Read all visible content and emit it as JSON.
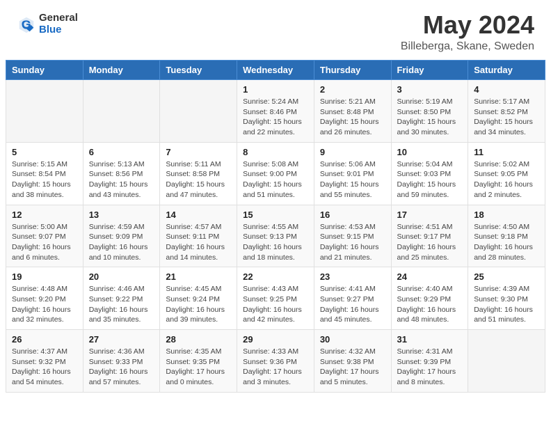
{
  "header": {
    "logo_general": "General",
    "logo_blue": "Blue",
    "month_year": "May 2024",
    "location": "Billeberga, Skane, Sweden"
  },
  "days_of_week": [
    "Sunday",
    "Monday",
    "Tuesday",
    "Wednesday",
    "Thursday",
    "Friday",
    "Saturday"
  ],
  "weeks": [
    [
      {
        "day": "",
        "content": ""
      },
      {
        "day": "",
        "content": ""
      },
      {
        "day": "",
        "content": ""
      },
      {
        "day": "1",
        "content": "Sunrise: 5:24 AM\nSunset: 8:46 PM\nDaylight: 15 hours\nand 22 minutes."
      },
      {
        "day": "2",
        "content": "Sunrise: 5:21 AM\nSunset: 8:48 PM\nDaylight: 15 hours\nand 26 minutes."
      },
      {
        "day": "3",
        "content": "Sunrise: 5:19 AM\nSunset: 8:50 PM\nDaylight: 15 hours\nand 30 minutes."
      },
      {
        "day": "4",
        "content": "Sunrise: 5:17 AM\nSunset: 8:52 PM\nDaylight: 15 hours\nand 34 minutes."
      }
    ],
    [
      {
        "day": "5",
        "content": "Sunrise: 5:15 AM\nSunset: 8:54 PM\nDaylight: 15 hours\nand 38 minutes."
      },
      {
        "day": "6",
        "content": "Sunrise: 5:13 AM\nSunset: 8:56 PM\nDaylight: 15 hours\nand 43 minutes."
      },
      {
        "day": "7",
        "content": "Sunrise: 5:11 AM\nSunset: 8:58 PM\nDaylight: 15 hours\nand 47 minutes."
      },
      {
        "day": "8",
        "content": "Sunrise: 5:08 AM\nSunset: 9:00 PM\nDaylight: 15 hours\nand 51 minutes."
      },
      {
        "day": "9",
        "content": "Sunrise: 5:06 AM\nSunset: 9:01 PM\nDaylight: 15 hours\nand 55 minutes."
      },
      {
        "day": "10",
        "content": "Sunrise: 5:04 AM\nSunset: 9:03 PM\nDaylight: 15 hours\nand 59 minutes."
      },
      {
        "day": "11",
        "content": "Sunrise: 5:02 AM\nSunset: 9:05 PM\nDaylight: 16 hours\nand 2 minutes."
      }
    ],
    [
      {
        "day": "12",
        "content": "Sunrise: 5:00 AM\nSunset: 9:07 PM\nDaylight: 16 hours\nand 6 minutes."
      },
      {
        "day": "13",
        "content": "Sunrise: 4:59 AM\nSunset: 9:09 PM\nDaylight: 16 hours\nand 10 minutes."
      },
      {
        "day": "14",
        "content": "Sunrise: 4:57 AM\nSunset: 9:11 PM\nDaylight: 16 hours\nand 14 minutes."
      },
      {
        "day": "15",
        "content": "Sunrise: 4:55 AM\nSunset: 9:13 PM\nDaylight: 16 hours\nand 18 minutes."
      },
      {
        "day": "16",
        "content": "Sunrise: 4:53 AM\nSunset: 9:15 PM\nDaylight: 16 hours\nand 21 minutes."
      },
      {
        "day": "17",
        "content": "Sunrise: 4:51 AM\nSunset: 9:17 PM\nDaylight: 16 hours\nand 25 minutes."
      },
      {
        "day": "18",
        "content": "Sunrise: 4:50 AM\nSunset: 9:18 PM\nDaylight: 16 hours\nand 28 minutes."
      }
    ],
    [
      {
        "day": "19",
        "content": "Sunrise: 4:48 AM\nSunset: 9:20 PM\nDaylight: 16 hours\nand 32 minutes."
      },
      {
        "day": "20",
        "content": "Sunrise: 4:46 AM\nSunset: 9:22 PM\nDaylight: 16 hours\nand 35 minutes."
      },
      {
        "day": "21",
        "content": "Sunrise: 4:45 AM\nSunset: 9:24 PM\nDaylight: 16 hours\nand 39 minutes."
      },
      {
        "day": "22",
        "content": "Sunrise: 4:43 AM\nSunset: 9:25 PM\nDaylight: 16 hours\nand 42 minutes."
      },
      {
        "day": "23",
        "content": "Sunrise: 4:41 AM\nSunset: 9:27 PM\nDaylight: 16 hours\nand 45 minutes."
      },
      {
        "day": "24",
        "content": "Sunrise: 4:40 AM\nSunset: 9:29 PM\nDaylight: 16 hours\nand 48 minutes."
      },
      {
        "day": "25",
        "content": "Sunrise: 4:39 AM\nSunset: 9:30 PM\nDaylight: 16 hours\nand 51 minutes."
      }
    ],
    [
      {
        "day": "26",
        "content": "Sunrise: 4:37 AM\nSunset: 9:32 PM\nDaylight: 16 hours\nand 54 minutes."
      },
      {
        "day": "27",
        "content": "Sunrise: 4:36 AM\nSunset: 9:33 PM\nDaylight: 16 hours\nand 57 minutes."
      },
      {
        "day": "28",
        "content": "Sunrise: 4:35 AM\nSunset: 9:35 PM\nDaylight: 17 hours\nand 0 minutes."
      },
      {
        "day": "29",
        "content": "Sunrise: 4:33 AM\nSunset: 9:36 PM\nDaylight: 17 hours\nand 3 minutes."
      },
      {
        "day": "30",
        "content": "Sunrise: 4:32 AM\nSunset: 9:38 PM\nDaylight: 17 hours\nand 5 minutes."
      },
      {
        "day": "31",
        "content": "Sunrise: 4:31 AM\nSunset: 9:39 PM\nDaylight: 17 hours\nand 8 minutes."
      },
      {
        "day": "",
        "content": ""
      }
    ]
  ]
}
